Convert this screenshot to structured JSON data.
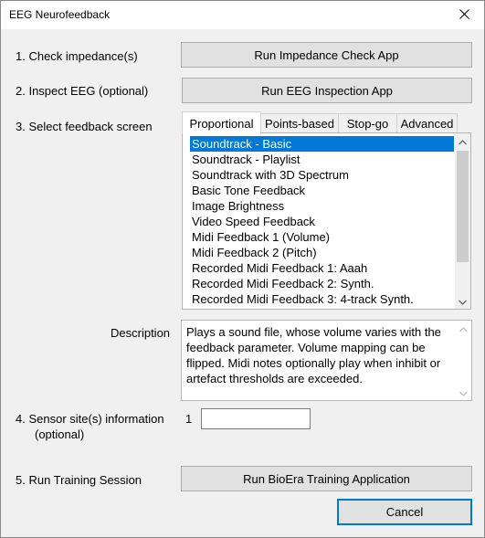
{
  "window": {
    "title": "EEG Neurofeedback",
    "close_glyph": "✕"
  },
  "steps": {
    "impedance_label": "1. Check impedance(s)",
    "impedance_button": "Run Impedance Check App",
    "inspect_label": "2. Inspect EEG (optional)",
    "inspect_button": "Run EEG Inspection App",
    "feedback_label": "3. Select feedback screen",
    "sensor_label_line1": "4. Sensor site(s) information",
    "sensor_label_line2": "(optional)",
    "sensor_index": "1",
    "sensor_value": "",
    "training_label": "5. Run Training Session",
    "training_button": "Run BioEra Training Application"
  },
  "tabs": [
    "Proportional",
    "Points-based",
    "Stop-go",
    "Advanced"
  ],
  "feedback_list": {
    "selected_index": 0,
    "items": [
      "Soundtrack - Basic",
      "Soundtrack - Playlist",
      "Soundtrack with 3D Spectrum",
      "Basic Tone Feedback",
      "Image Brightness",
      "Video Speed Feedback",
      "Midi Feedback 1 (Volume)",
      "Midi Feedback 2 (Pitch)",
      "Recorded Midi Feedback 1: Aaah",
      "Recorded Midi Feedback 2: Synth.",
      "Recorded Midi Feedback 3: 4-track Synth."
    ]
  },
  "description": {
    "label": "Description",
    "text": "Plays a sound file, whose volume varies with the feedback parameter. Volume mapping can be flipped. Midi notes optionally play when inhibit or artefact thresholds are exceeded."
  },
  "footer": {
    "cancel_button": "Cancel"
  },
  "colors": {
    "accent": "#0078d7",
    "button_bg": "#e1e1e1",
    "window_bg": "#f0f0f0"
  }
}
